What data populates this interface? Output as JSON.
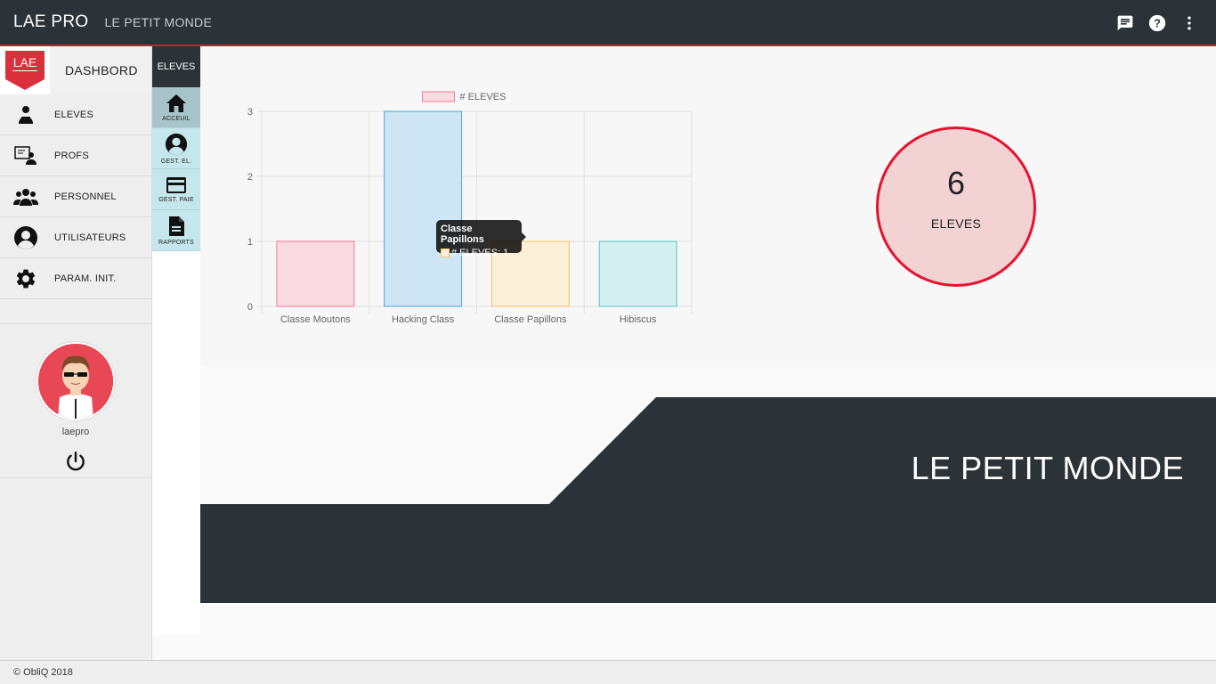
{
  "header": {
    "app_title": "LAE PRO",
    "subtitle": "LE PETIT MONDE",
    "icons": [
      "chat-icon",
      "help-icon",
      "more-vert-icon"
    ]
  },
  "sidebar": {
    "logo_text": "LAE",
    "dashboard_label": "DASHBORD",
    "items": [
      {
        "label": "ELEVES",
        "icon": "students-icon"
      },
      {
        "label": "PROFS",
        "icon": "teacher-icon"
      },
      {
        "label": "PERSONNEL",
        "icon": "group-icon"
      },
      {
        "label": "UTILISATEURS",
        "icon": "user-circle-icon"
      },
      {
        "label": "PARAM. INIT.",
        "icon": "gear-icon"
      }
    ],
    "username": "laepro"
  },
  "subnav": {
    "header": "ELEVES",
    "items": [
      {
        "label": "ACCEUIL",
        "icon": "home-icon"
      },
      {
        "label": "GEST. EL.",
        "icon": "account-icon"
      },
      {
        "label": "GEST. PAIE",
        "icon": "credit-card-icon"
      },
      {
        "label": "RAPPORTS",
        "icon": "document-icon"
      }
    ]
  },
  "chart_data": {
    "type": "bar",
    "categories": [
      "Classe Moutons",
      "Hacking Class",
      "Classe Papillons",
      "Hibiscus"
    ],
    "series": [
      {
        "name": "# ELEVES",
        "values": [
          1,
          3,
          1,
          1
        ]
      }
    ],
    "ylim": [
      0,
      3
    ],
    "yticks": [
      0,
      1,
      2,
      3
    ],
    "grid": true,
    "legend_position": "top",
    "colors": {
      "fills": [
        "#fadbe2",
        "#cde5f4",
        "#fcefd8",
        "#d5f0f0"
      ],
      "strokes": [
        "#f07a95",
        "#4aa6e0",
        "#f5c16a",
        "#5cc3c3"
      ]
    }
  },
  "tooltip": {
    "title": "Classe Papillons",
    "line": "# ELEVES: 1"
  },
  "counter": {
    "value": "6",
    "label": "ELEVES"
  },
  "banner": {
    "title": "LE PETIT MONDE"
  },
  "footer": {
    "text": "© ObliQ 2018"
  },
  "colors": {
    "dark": "#2b3338",
    "accent": "#e8112d"
  }
}
